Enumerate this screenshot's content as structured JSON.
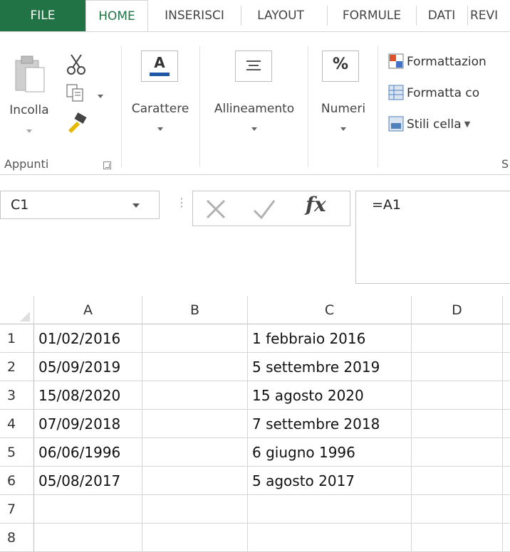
{
  "tabs": {
    "file": "FILE",
    "home": "HOME",
    "inserisci": "INSERISCI",
    "layout": "LAYOUT",
    "formule": "FORMULE",
    "dati": "DATI",
    "revisione": "REVI"
  },
  "ribbon": {
    "incolla": "Incolla",
    "appunti": "Appunti",
    "carattere": "Carattere",
    "allineamento": "Allineamento",
    "numeri": "Numeri",
    "formattazione": "Formattazion",
    "formatta_come": "Formatta co",
    "stili_cella": "Stili cella",
    "stili_group": "S",
    "font_icon_letter": "A",
    "percent_symbol": "%"
  },
  "formula_bar": {
    "name_box": "C1",
    "dots": "⋮",
    "fx": "fx",
    "formula": "=A1"
  },
  "grid": {
    "columns": [
      "A",
      "B",
      "C",
      "D"
    ],
    "rows": [
      {
        "num": "1",
        "a": "01/02/2016",
        "b": "",
        "c": "1 febbraio 2016",
        "d": ""
      },
      {
        "num": "2",
        "a": "05/09/2019",
        "b": "",
        "c": "5 settembre 2019",
        "d": ""
      },
      {
        "num": "3",
        "a": "15/08/2020",
        "b": "",
        "c": "15 agosto 2020",
        "d": ""
      },
      {
        "num": "4",
        "a": "07/09/2018",
        "b": "",
        "c": "7 settembre 2018",
        "d": ""
      },
      {
        "num": "5",
        "a": "06/06/1996",
        "b": "",
        "c": "6 giugno 1996",
        "d": ""
      },
      {
        "num": "6",
        "a": "05/08/2017",
        "b": "",
        "c": "5 agosto 2017",
        "d": ""
      },
      {
        "num": "7",
        "a": "",
        "b": "",
        "c": "",
        "d": ""
      },
      {
        "num": "8",
        "a": "",
        "b": "",
        "c": "",
        "d": ""
      }
    ]
  },
  "colors": {
    "accent": "#217346"
  }
}
